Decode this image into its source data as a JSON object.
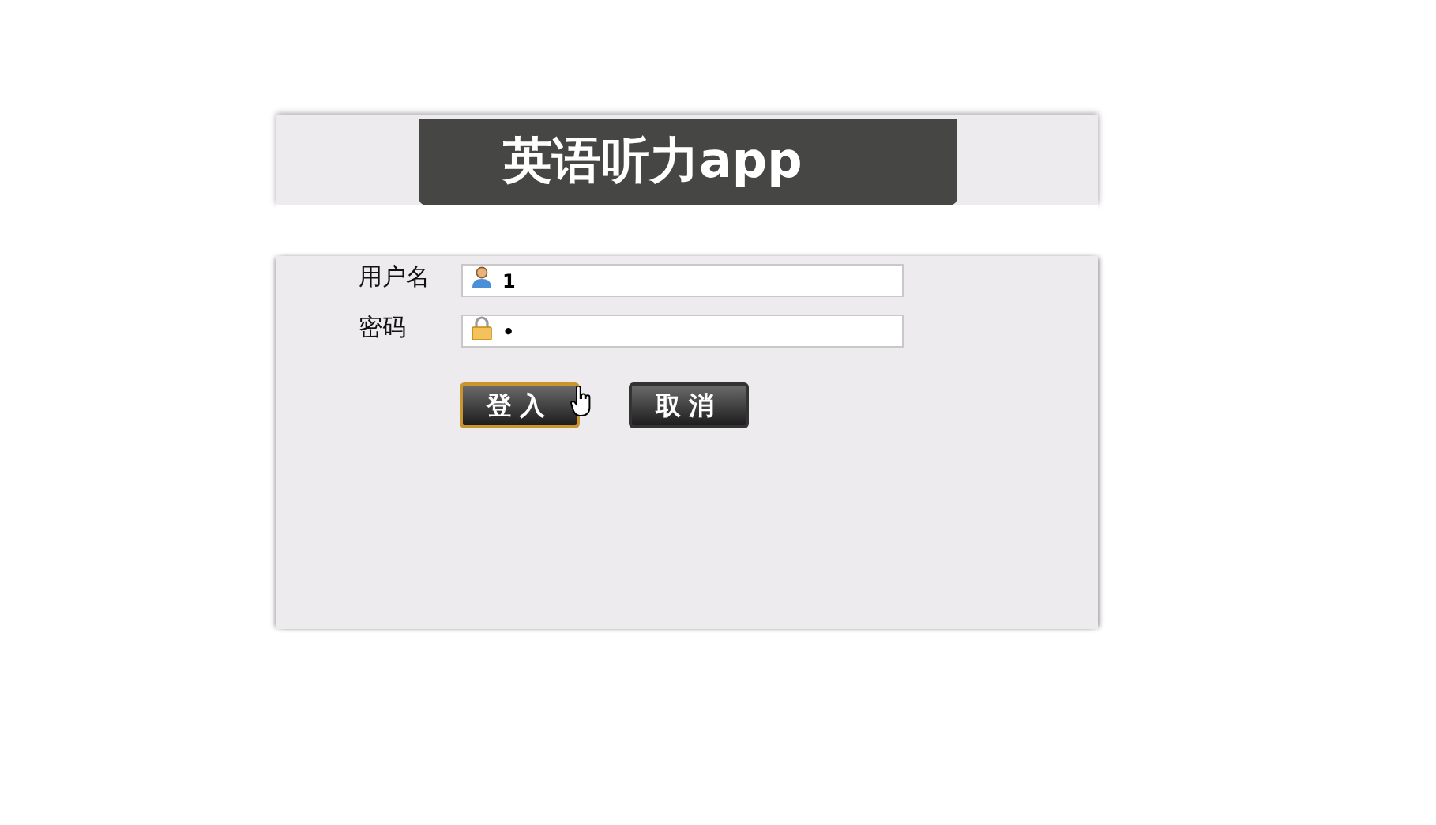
{
  "header": {
    "title": "英语听力app"
  },
  "fields": [
    {
      "label": "用户名",
      "kind": "user",
      "value": "1"
    },
    {
      "label": "密码",
      "kind": "lock",
      "value": "•"
    }
  ],
  "buttons": [
    {
      "label": "登入",
      "focused": true
    },
    {
      "label": "取消",
      "focused": false
    }
  ]
}
